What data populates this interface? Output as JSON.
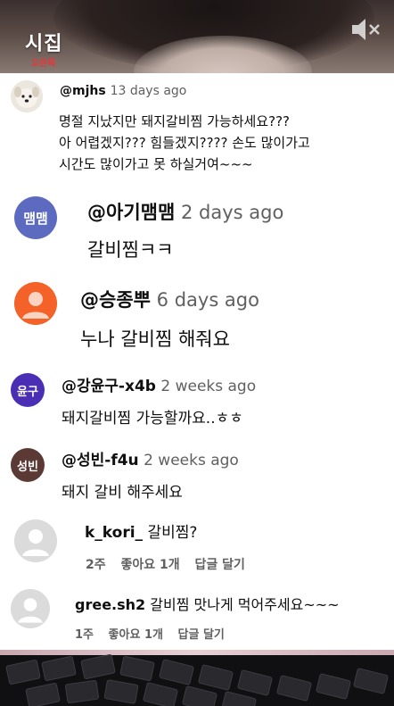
{
  "video": {
    "logo_main": "시집",
    "logo_sub": "오픈톡"
  },
  "comments": [
    {
      "handle": "@mjhs",
      "age": "13 days ago",
      "lines": [
        "명절 지났지만 돼지갈비찜 가능하세요???",
        "아 어렵겠지??? 힘들겠지???? 손도 많이가고",
        "시간도 많이가고 못 하실거여~~~"
      ]
    },
    {
      "avatar_text": "맴맴",
      "avatar_color": "#5c6bc0",
      "handle": "@아기맴맴",
      "age": "2 days ago",
      "lines": [
        "갈비찜ㅋㅋ"
      ]
    },
    {
      "avatar_color": "#f4622a",
      "handle": "@승종뿌",
      "age": "6 days ago",
      "lines": [
        "누나 갈비찜 해줘요"
      ]
    },
    {
      "avatar_text": "윤구",
      "avatar_color": "#4a2fb5",
      "handle": "@강윤구-x4b",
      "age": "2 weeks ago",
      "lines": [
        "돼지갈비찜 가능할까요..ㅎㅎ"
      ]
    },
    {
      "avatar_text": "성빈",
      "avatar_color": "#5b3a35",
      "handle": "@성빈-f4u",
      "age": "2 weeks ago",
      "lines": [
        "돼지 갈비 해주세요"
      ]
    },
    {
      "handle": "k_kori_",
      "text": "갈비찜?",
      "meta": [
        "2주",
        "좋아요 1개",
        "답글 달기"
      ]
    },
    {
      "handle": "gree.sh2",
      "text": "갈비찜 맛나게 먹어주세요~~~",
      "meta": [
        "1주",
        "좋아요 1개",
        "답글 달기"
      ]
    }
  ],
  "colors": {
    "secondary_text": "#606060",
    "primary_text": "#0f0f0f"
  },
  "icons": [
    "mute-icon",
    "dog-avatar",
    "default-user-avatar"
  ]
}
